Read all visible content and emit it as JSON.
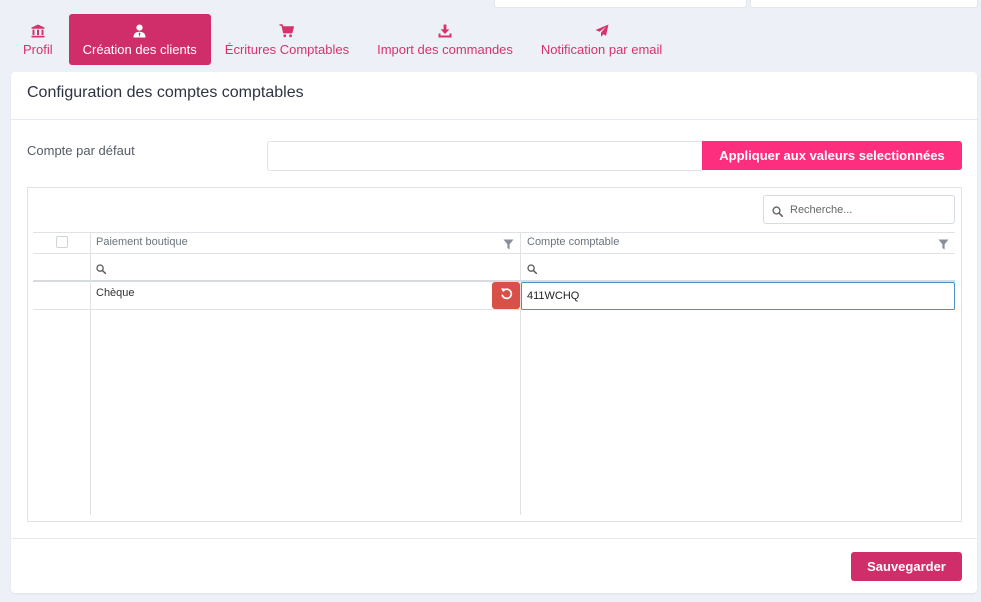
{
  "tabs": [
    {
      "label": "Profil",
      "icon": "bank-icon"
    },
    {
      "label": "Création des clients",
      "icon": "user-tie-icon",
      "active": true
    },
    {
      "label": "Écritures Comptables",
      "icon": "cart-icon"
    },
    {
      "label": "Import des commandes",
      "icon": "download-icon"
    },
    {
      "label": "Notification par email",
      "icon": "send-icon"
    }
  ],
  "card": {
    "title": "Configuration des comptes comptables"
  },
  "default_account": {
    "label": "Compte par défaut",
    "value": "",
    "apply_label": "Appliquer aux valeurs selectionnées"
  },
  "grid": {
    "search_placeholder": "Recherche...",
    "columns": [
      "Paiement boutique",
      "Compte comptable"
    ],
    "rows": [
      {
        "payment": "Chèque",
        "account": "411WCHQ"
      }
    ]
  },
  "footer": {
    "save_label": "Sauvegarder"
  },
  "colors": {
    "accent": "#d02e6a",
    "apply": "#fd2e7e",
    "undo": "#d85148"
  }
}
